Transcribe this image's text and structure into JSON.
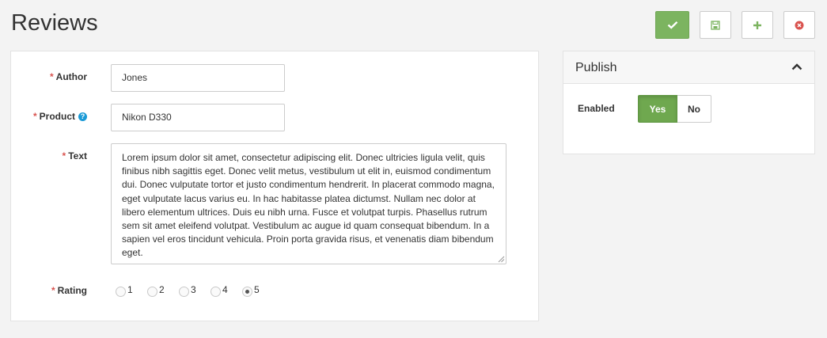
{
  "page": {
    "title": "Reviews"
  },
  "toolbar": {
    "buttons": [
      {
        "name": "save-close-button",
        "icon": "check-icon",
        "color": "#7cb460"
      },
      {
        "name": "save-button",
        "icon": "floppy-disk-icon",
        "color": "#7cb460"
      },
      {
        "name": "new-button",
        "icon": "plus-icon",
        "color": "#7cb460"
      },
      {
        "name": "cancel-button",
        "icon": "close-circle-icon",
        "color": "#d9534f"
      }
    ]
  },
  "form": {
    "required_marker": "*",
    "author": {
      "label": "Author",
      "value": "Jones"
    },
    "product": {
      "label": "Product",
      "value": "Nikon D330",
      "help_icon": "question-circle-icon"
    },
    "text": {
      "label": "Text",
      "value": "Lorem ipsum dolor sit amet, consectetur adipiscing elit. Donec ultricies ligula velit, quis finibus nibh sagittis eget. Donec velit metus, vestibulum ut elit in, euismod condimentum dui. Donec vulputate tortor et justo condimentum hendrerit. In placerat commodo magna, eget vulputate lacus varius eu. In hac habitasse platea dictumst. Nullam nec dolor at libero elementum ultrices. Duis eu nibh urna. Fusce et volutpat turpis. Phasellus rutrum sem sit amet eleifend volutpat. Vestibulum ac augue id quam consequat bibendum. In a sapien vel eros tincidunt vehicula. Proin porta gravida risus, et venenatis diam bibendum eget."
    },
    "rating": {
      "label": "Rating",
      "options": [
        "1",
        "2",
        "3",
        "4",
        "5"
      ],
      "selected": "5"
    }
  },
  "publish": {
    "title": "Publish",
    "enabled_label": "Enabled",
    "yes_label": "Yes",
    "no_label": "No",
    "enabled": true,
    "accent_color": "#6fa84f"
  }
}
